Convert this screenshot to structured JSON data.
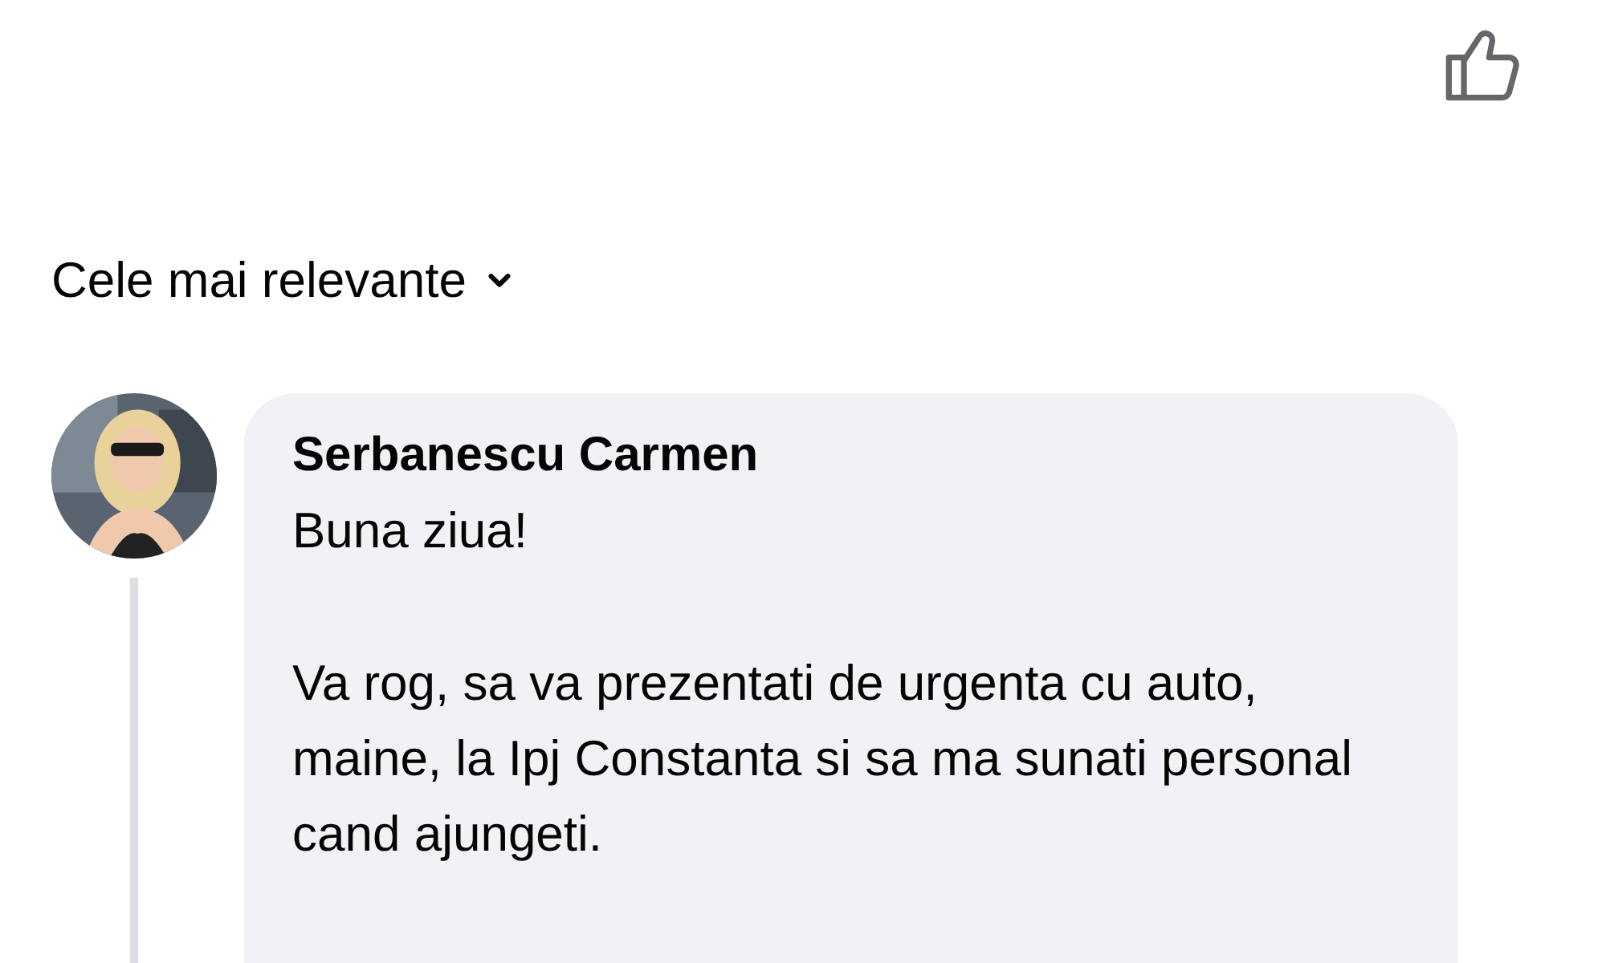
{
  "sort": {
    "label": "Cele mai relevante"
  },
  "comment": {
    "author": "Serbanescu Carmen",
    "paragraphs": [
      "Buna ziua!",
      "Va rog, sa va prezentati de urgenta cu auto, maine, la Ipj Constanta si sa ma sunati personal cand ajungeti."
    ]
  }
}
